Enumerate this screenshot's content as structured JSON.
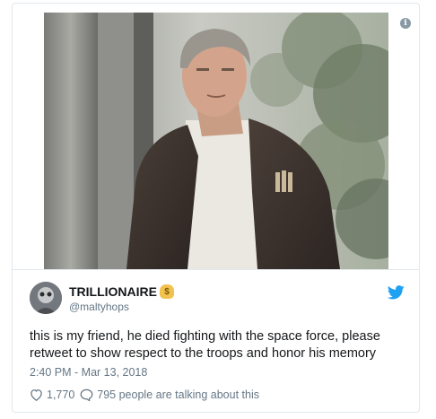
{
  "tweet": {
    "display_name": "TRILLIONAIRE",
    "badge_emoji": "$",
    "handle": "@maltyhops",
    "text": "this is my friend, he died fighting with the space force, please retweet to show respect to the troops and honor his memory",
    "timestamp": "2:40 PM - Mar 13, 2018",
    "likes": "1,770",
    "conversation": "795 people are talking about this"
  },
  "icons": {
    "info": "info-icon",
    "platform": "bird-icon",
    "like": "heart-icon",
    "reply": "speech-bubble-icon",
    "badge": "money-bag-icon"
  },
  "colors": {
    "text": "#14171a",
    "secondary_text": "#657786",
    "brand_blue": "#1da1f2",
    "border": "#e1e8ed",
    "info_icon": "#8899a6"
  }
}
